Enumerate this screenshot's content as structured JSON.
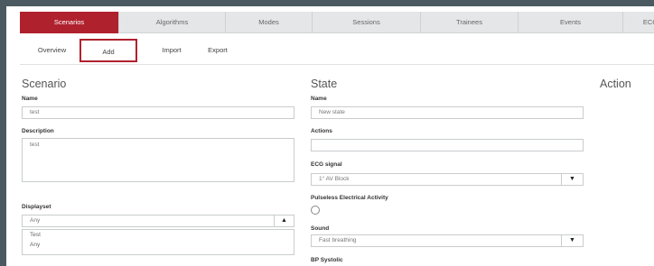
{
  "main_tabs": [
    "Scenarios",
    "Algorithms",
    "Modes",
    "Sessions",
    "Trainees",
    "Events",
    "ECG"
  ],
  "sub_tabs": [
    "Overview",
    "Add",
    "Import",
    "Export"
  ],
  "scenario": {
    "heading": "Scenario",
    "name_label": "Name",
    "name_value": "test",
    "description_label": "Description",
    "description_value": "test",
    "displayset_label": "Displayset",
    "displayset_value": "Any",
    "displayset_options": [
      "Test",
      "Any"
    ],
    "dropdown_icon": "triangle-up-icon"
  },
  "state": {
    "heading": "State",
    "name_label": "Name",
    "name_placeholder": "New state",
    "actions_label": "Actions",
    "actions_value": "",
    "ecg_label": "ECG signal",
    "ecg_value": "1° AV Block",
    "pea_label": "Pulseless Electrical Activity",
    "sound_label": "Sound",
    "sound_value": "Fast breathing",
    "bp_label": "BP Systolic",
    "select_icon": "triangle-down-icon"
  },
  "action": {
    "heading": "Action"
  },
  "colors": {
    "accent": "#b0212e",
    "frame": "#4a5a60",
    "tabbar": "#e4e6e7"
  }
}
